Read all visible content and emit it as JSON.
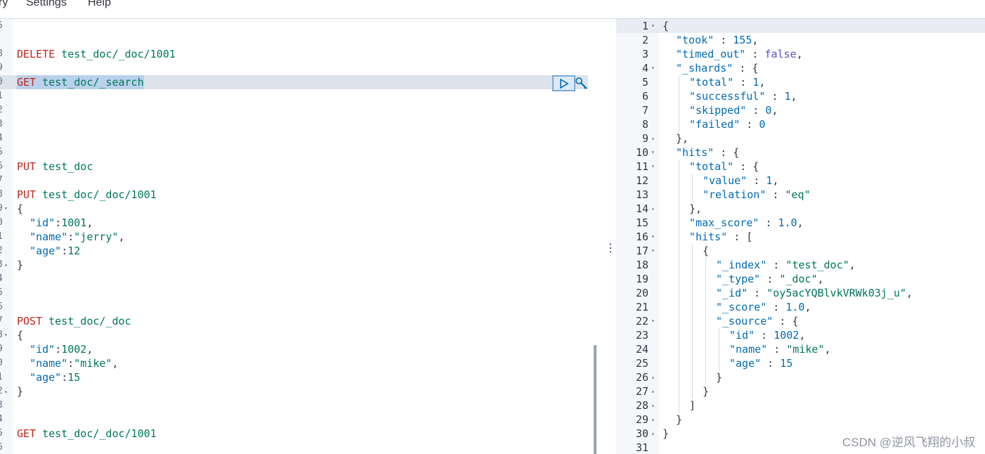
{
  "menu": {
    "items": [
      "ry",
      "Settings",
      "Help"
    ]
  },
  "editor": {
    "gutter_numbers": [
      "5",
      "",
      "8",
      "9",
      "0",
      "1",
      "2",
      "3",
      "4",
      "5",
      "6",
      "7",
      "8",
      "9",
      "0",
      "1",
      "2",
      "3",
      "4",
      "5",
      "6",
      "7",
      "8",
      "9",
      "0",
      "1",
      "2",
      "3",
      "4",
      "5",
      "6"
    ],
    "requests": {
      "delete": {
        "method": "DELETE",
        "path": "test_doc/_doc/1001"
      },
      "search": {
        "method": "GET",
        "path": "test_doc/_search"
      },
      "put_index": {
        "method": "PUT",
        "path": "test_doc"
      },
      "put_doc": {
        "method": "PUT",
        "path": "test_doc/_doc/1001"
      },
      "post_doc": {
        "method": "POST",
        "path": "test_doc/_doc"
      },
      "get_doc": {
        "method": "GET",
        "path": "test_doc/_doc/1001"
      }
    },
    "doc1": {
      "id": "1001",
      "name": "\"jerry\"",
      "age": "12"
    },
    "doc2": {
      "id": "1002",
      "name": "\"mike\"",
      "age": "15"
    },
    "keys": {
      "id": "\"id\"",
      "name": "\"name\"",
      "age": "\"age\""
    },
    "braces": {
      "open": "{",
      "close": "}"
    },
    "run_icon": "play-icon",
    "wrench_icon": "wrench-icon",
    "divider_icon": "⋮"
  },
  "response": {
    "lines": [
      {
        "n": "1",
        "fold": "▾",
        "indent": 0,
        "parts": [
          [
            "p",
            "{"
          ]
        ]
      },
      {
        "n": "2",
        "fold": "",
        "indent": 1,
        "parts": [
          [
            "k",
            "\"took\""
          ],
          [
            "p",
            " : "
          ],
          [
            "n",
            "155"
          ],
          [
            "p",
            ","
          ]
        ]
      },
      {
        "n": "3",
        "fold": "",
        "indent": 1,
        "parts": [
          [
            "k",
            "\"timed_out\""
          ],
          [
            "p",
            " : "
          ],
          [
            "b",
            "false"
          ],
          [
            "p",
            ","
          ]
        ]
      },
      {
        "n": "4",
        "fold": "▾",
        "indent": 1,
        "parts": [
          [
            "k",
            "\"_shards\""
          ],
          [
            "p",
            " : {"
          ]
        ]
      },
      {
        "n": "5",
        "fold": "",
        "indent": 2,
        "parts": [
          [
            "k",
            "\"total\""
          ],
          [
            "p",
            " : "
          ],
          [
            "n",
            "1"
          ],
          [
            "p",
            ","
          ]
        ]
      },
      {
        "n": "6",
        "fold": "",
        "indent": 2,
        "parts": [
          [
            "k",
            "\"successful\""
          ],
          [
            "p",
            " : "
          ],
          [
            "n",
            "1"
          ],
          [
            "p",
            ","
          ]
        ]
      },
      {
        "n": "7",
        "fold": "",
        "indent": 2,
        "parts": [
          [
            "k",
            "\"skipped\""
          ],
          [
            "p",
            " : "
          ],
          [
            "n",
            "0"
          ],
          [
            "p",
            ","
          ]
        ]
      },
      {
        "n": "8",
        "fold": "",
        "indent": 2,
        "parts": [
          [
            "k",
            "\"failed\""
          ],
          [
            "p",
            " : "
          ],
          [
            "n",
            "0"
          ]
        ]
      },
      {
        "n": "9",
        "fold": "▴",
        "indent": 1,
        "parts": [
          [
            "p",
            "},"
          ]
        ]
      },
      {
        "n": "10",
        "fold": "▾",
        "indent": 1,
        "parts": [
          [
            "k",
            "\"hits\""
          ],
          [
            "p",
            " : {"
          ]
        ]
      },
      {
        "n": "11",
        "fold": "▾",
        "indent": 2,
        "parts": [
          [
            "k",
            "\"total\""
          ],
          [
            "p",
            " : {"
          ]
        ]
      },
      {
        "n": "12",
        "fold": "",
        "indent": 3,
        "parts": [
          [
            "k",
            "\"value\""
          ],
          [
            "p",
            " : "
          ],
          [
            "n",
            "1"
          ],
          [
            "p",
            ","
          ]
        ]
      },
      {
        "n": "13",
        "fold": "",
        "indent": 3,
        "parts": [
          [
            "k",
            "\"relation\""
          ],
          [
            "p",
            " : "
          ],
          [
            "s",
            "\"eq\""
          ]
        ]
      },
      {
        "n": "14",
        "fold": "▴",
        "indent": 2,
        "parts": [
          [
            "p",
            "},"
          ]
        ]
      },
      {
        "n": "15",
        "fold": "",
        "indent": 2,
        "parts": [
          [
            "k",
            "\"max_score\""
          ],
          [
            "p",
            " : "
          ],
          [
            "n",
            "1.0"
          ],
          [
            "p",
            ","
          ]
        ]
      },
      {
        "n": "16",
        "fold": "▾",
        "indent": 2,
        "parts": [
          [
            "k",
            "\"hits\""
          ],
          [
            "p",
            " : ["
          ]
        ]
      },
      {
        "n": "17",
        "fold": "▾",
        "indent": 3,
        "parts": [
          [
            "p",
            "{"
          ]
        ]
      },
      {
        "n": "18",
        "fold": "",
        "indent": 4,
        "parts": [
          [
            "k",
            "\"_index\""
          ],
          [
            "p",
            " : "
          ],
          [
            "s",
            "\"test_doc\""
          ],
          [
            "p",
            ","
          ]
        ]
      },
      {
        "n": "19",
        "fold": "",
        "indent": 4,
        "parts": [
          [
            "k",
            "\"_type\""
          ],
          [
            "p",
            " : "
          ],
          [
            "s",
            "\"_doc\""
          ],
          [
            "p",
            ","
          ]
        ]
      },
      {
        "n": "20",
        "fold": "",
        "indent": 4,
        "parts": [
          [
            "k",
            "\"_id\""
          ],
          [
            "p",
            " : "
          ],
          [
            "s",
            "\"oy5acYQBlvkVRWk03j_u\""
          ],
          [
            "p",
            ","
          ]
        ]
      },
      {
        "n": "21",
        "fold": "",
        "indent": 4,
        "parts": [
          [
            "k",
            "\"_score\""
          ],
          [
            "p",
            " : "
          ],
          [
            "n",
            "1.0"
          ],
          [
            "p",
            ","
          ]
        ]
      },
      {
        "n": "22",
        "fold": "▾",
        "indent": 4,
        "parts": [
          [
            "k",
            "\"_source\""
          ],
          [
            "p",
            " : {"
          ]
        ]
      },
      {
        "n": "23",
        "fold": "",
        "indent": 5,
        "parts": [
          [
            "k",
            "\"id\""
          ],
          [
            "p",
            " : "
          ],
          [
            "n",
            "1002"
          ],
          [
            "p",
            ","
          ]
        ]
      },
      {
        "n": "24",
        "fold": "",
        "indent": 5,
        "parts": [
          [
            "k",
            "\"name\""
          ],
          [
            "p",
            " : "
          ],
          [
            "s",
            "\"mike\""
          ],
          [
            "p",
            ","
          ]
        ]
      },
      {
        "n": "25",
        "fold": "",
        "indent": 5,
        "parts": [
          [
            "k",
            "\"age\""
          ],
          [
            "p",
            " : "
          ],
          [
            "n",
            "15"
          ]
        ]
      },
      {
        "n": "26",
        "fold": "▴",
        "indent": 4,
        "parts": [
          [
            "p",
            "}"
          ]
        ]
      },
      {
        "n": "27",
        "fold": "▴",
        "indent": 3,
        "parts": [
          [
            "p",
            "}"
          ]
        ]
      },
      {
        "n": "28",
        "fold": "▴",
        "indent": 2,
        "parts": [
          [
            "p",
            "]"
          ]
        ]
      },
      {
        "n": "29",
        "fold": "▴",
        "indent": 1,
        "parts": [
          [
            "p",
            "}"
          ]
        ]
      },
      {
        "n": "30",
        "fold": "▴",
        "indent": 0,
        "parts": [
          [
            "p",
            "}"
          ]
        ]
      },
      {
        "n": "31",
        "fold": "",
        "indent": 0,
        "parts": []
      }
    ]
  },
  "watermark": "CSDN @逆风飞翔的小叔"
}
